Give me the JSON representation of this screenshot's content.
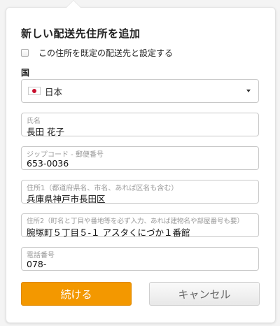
{
  "dialog": {
    "title": "新しい配送先住所を追加",
    "default_checkbox_label": "この住所を既定の配送先と設定する",
    "default_checked": false,
    "country_label": "国",
    "country_value": "日本",
    "country_flag_icon": "japan-flag-icon"
  },
  "fields": {
    "name": {
      "label": "氏名",
      "value": "長田 花子"
    },
    "zip": {
      "label": "ジップコード - 郵便番号",
      "value": "653-0036"
    },
    "address1": {
      "label": "住所1（都道府県名、市名、あれば区名も含む）",
      "value": "兵庫県神戸市長田区"
    },
    "address2": {
      "label": "住所2（町名と丁目や番地等を必ず入力、あれば建物名や部屋番号も要）",
      "value": "腕塚町５丁目５-１ アスタくにづか１番館"
    },
    "phone": {
      "label": "電話番号",
      "value": "078-"
    }
  },
  "buttons": {
    "continue": "続ける",
    "cancel": "キャンセル"
  },
  "colors": {
    "accent": "#f39800",
    "flag_red": "#c8102e"
  }
}
